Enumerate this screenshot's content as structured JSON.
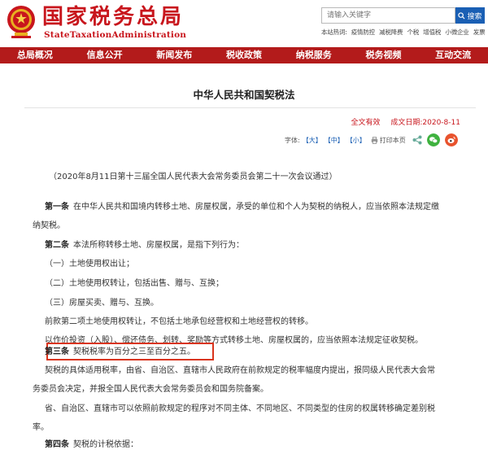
{
  "header": {
    "logo_cn": "国家税务总局",
    "logo_en": "StateTaxationAdministration",
    "search_placeholder": "请输入关键字",
    "search_button": "搜索",
    "hot_prefix": "本站热词:",
    "hot_words": [
      "疫情防控",
      "减税降费",
      "个税",
      "增值税",
      "小微企业",
      "发票"
    ]
  },
  "nav": {
    "items": [
      "总局概况",
      "信息公开",
      "新闻发布",
      "税收政策",
      "纳税服务",
      "税务视频",
      "互动交流"
    ]
  },
  "article": {
    "title": "中华人民共和国契税法",
    "status": "全文有效",
    "date": "成文日期:2020-8-11",
    "font_label": "字体:",
    "font_large": "【大】",
    "font_medium": "【中】",
    "font_small": "【小】",
    "print": "打印本页",
    "subtitle": "（2020年8月11日第十三届全国人民代表大会常务委员会第二十一次会议通过）",
    "p1_head": "第一条",
    "p1_line1": "在中华人民共和国境内转移土地、房屋权属，承受的单位和个人为契税的纳税人，应当依照本法规定缴",
    "p1_line2": "纳契税。",
    "p2_head": "第二条",
    "p2_text": "本法所称转移土地、房屋权属，是指下列行为：",
    "item1": "（一）土地使用权出让；",
    "item2": "（二）土地使用权转让，包括出售、赠与、互换；",
    "item3": "（三）房屋买卖、赠与、互换。",
    "p2b": "前款第二项土地使用权转让，不包括土地承包经营权和土地经营权的转移。",
    "p2c": "以作价投资（入股）、偿还债务、划转、奖励等方式转移土地、房屋权属的，应当依照本法规定征收契税。",
    "p3_head": "第三条",
    "p3_text": "契税税率为百分之三至百分之五。",
    "p3b_line1": "契税的具体适用税率，由省、自治区、直辖市人民政府在前款规定的税率幅度内提出，报同级人民代表大会常",
    "p3b_line2": "务委员会决定，并报全国人民代表大会常务委员会和国务院备案。",
    "p3c_line1": "省、自治区、直辖市可以依照前款规定的程序对不同主体、不同地区、不同类型的住房的权属转移确定差别税",
    "p3c_line2": "率。",
    "p4_head": "第四条",
    "p4_text": "契税的计税依据："
  },
  "colors": {
    "brand_red": "#c8161d",
    "nav_red": "#b31b1b",
    "link_blue": "#1a5fb4",
    "highlight": "#d9341c"
  }
}
